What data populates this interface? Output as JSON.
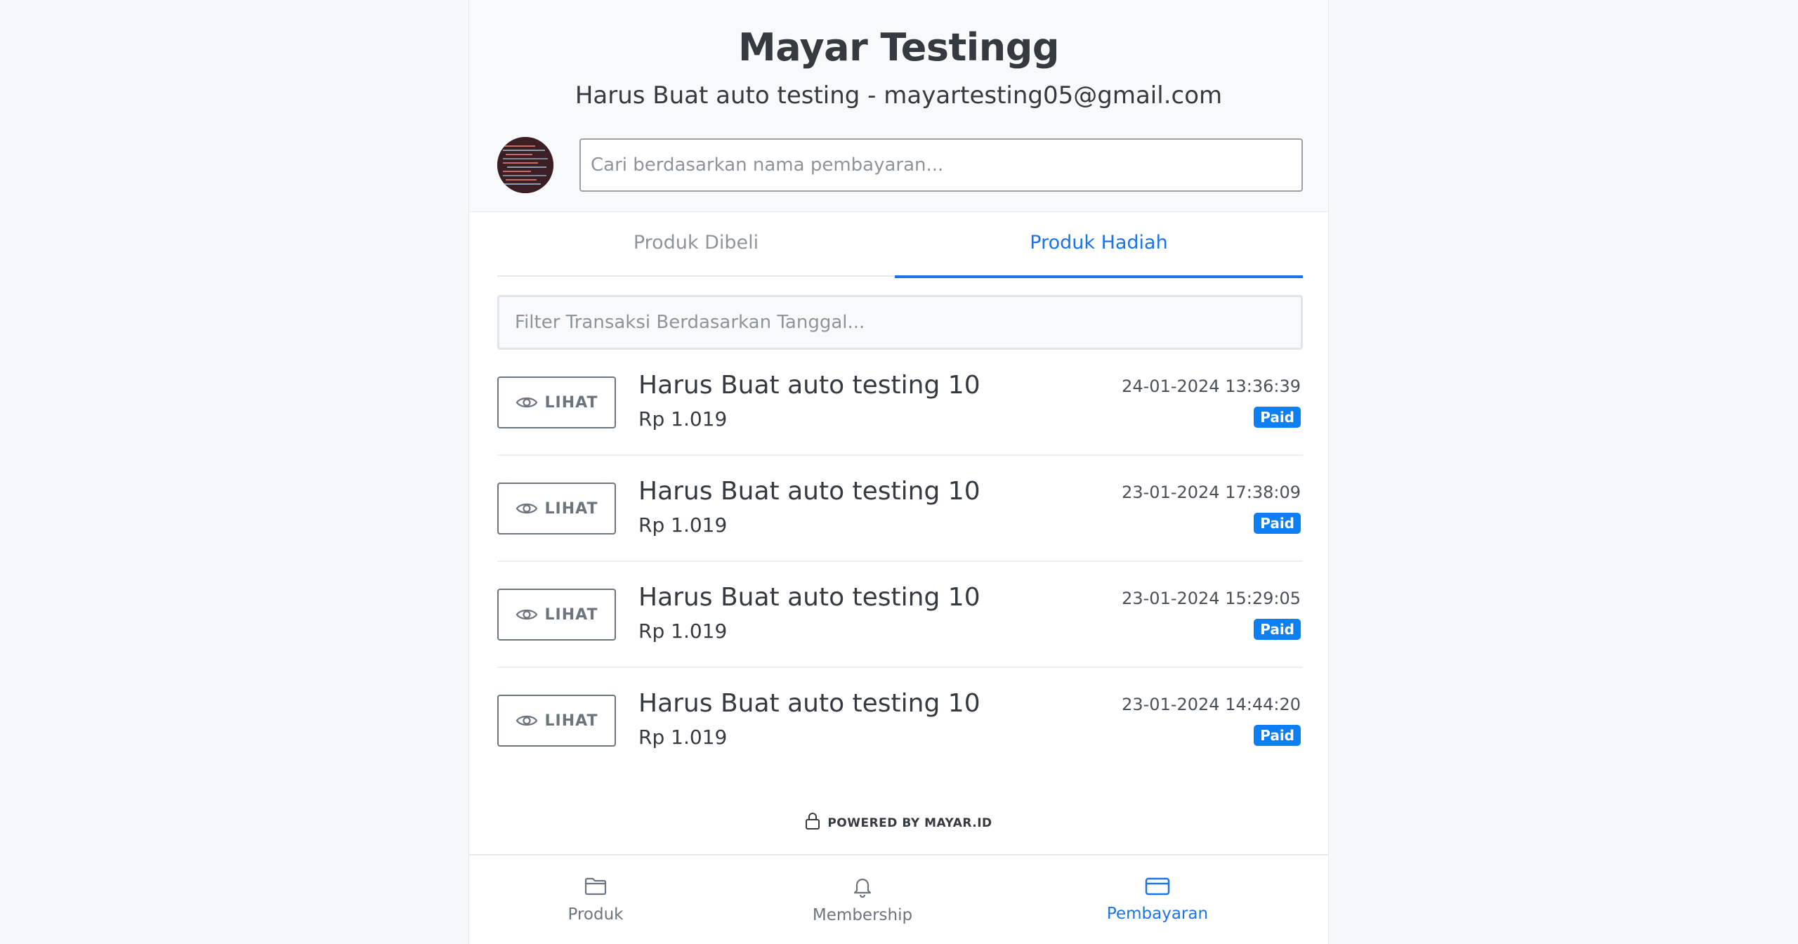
{
  "store": {
    "title": "Mayar Testingg",
    "subtitle": "Harus Buat auto testing - mayartesting05@gmail.com"
  },
  "search": {
    "placeholder": "Cari berdasarkan nama pembayaran..."
  },
  "tabs": [
    {
      "label": "Produk Dibeli",
      "active": false
    },
    {
      "label": "Produk Hadiah",
      "active": true
    }
  ],
  "date_filter": {
    "placeholder": "Filter Transaksi Berdasarkan Tanggal..."
  },
  "transactions": [
    {
      "view_label": "LIHAT",
      "name": "Harus Buat auto testing 10",
      "amount": "Rp 1.019",
      "date": "24-01-2024 13:36:39",
      "status": "Paid"
    },
    {
      "view_label": "LIHAT",
      "name": "Harus Buat auto testing 10",
      "amount": "Rp 1.019",
      "date": "23-01-2024 17:38:09",
      "status": "Paid"
    },
    {
      "view_label": "LIHAT",
      "name": "Harus Buat auto testing 10",
      "amount": "Rp 1.019",
      "date": "23-01-2024 15:29:05",
      "status": "Paid"
    },
    {
      "view_label": "LIHAT",
      "name": "Harus Buat auto testing 10",
      "amount": "Rp 1.019",
      "date": "23-01-2024 14:44:20",
      "status": "Paid"
    }
  ],
  "footer": {
    "powered_by": "POWERED BY MAYAR.ID"
  },
  "bottom_nav": [
    {
      "label": "Produk",
      "icon": "folder-icon",
      "active": false
    },
    {
      "label": "Membership",
      "icon": "bell-icon",
      "active": false
    },
    {
      "label": "Pembayaran",
      "icon": "credit-card-icon",
      "active": true
    }
  ],
  "colors": {
    "accent": "#1a73e8",
    "badge": "#0d7ff5",
    "text": "#343a40",
    "muted": "#8d949b"
  }
}
